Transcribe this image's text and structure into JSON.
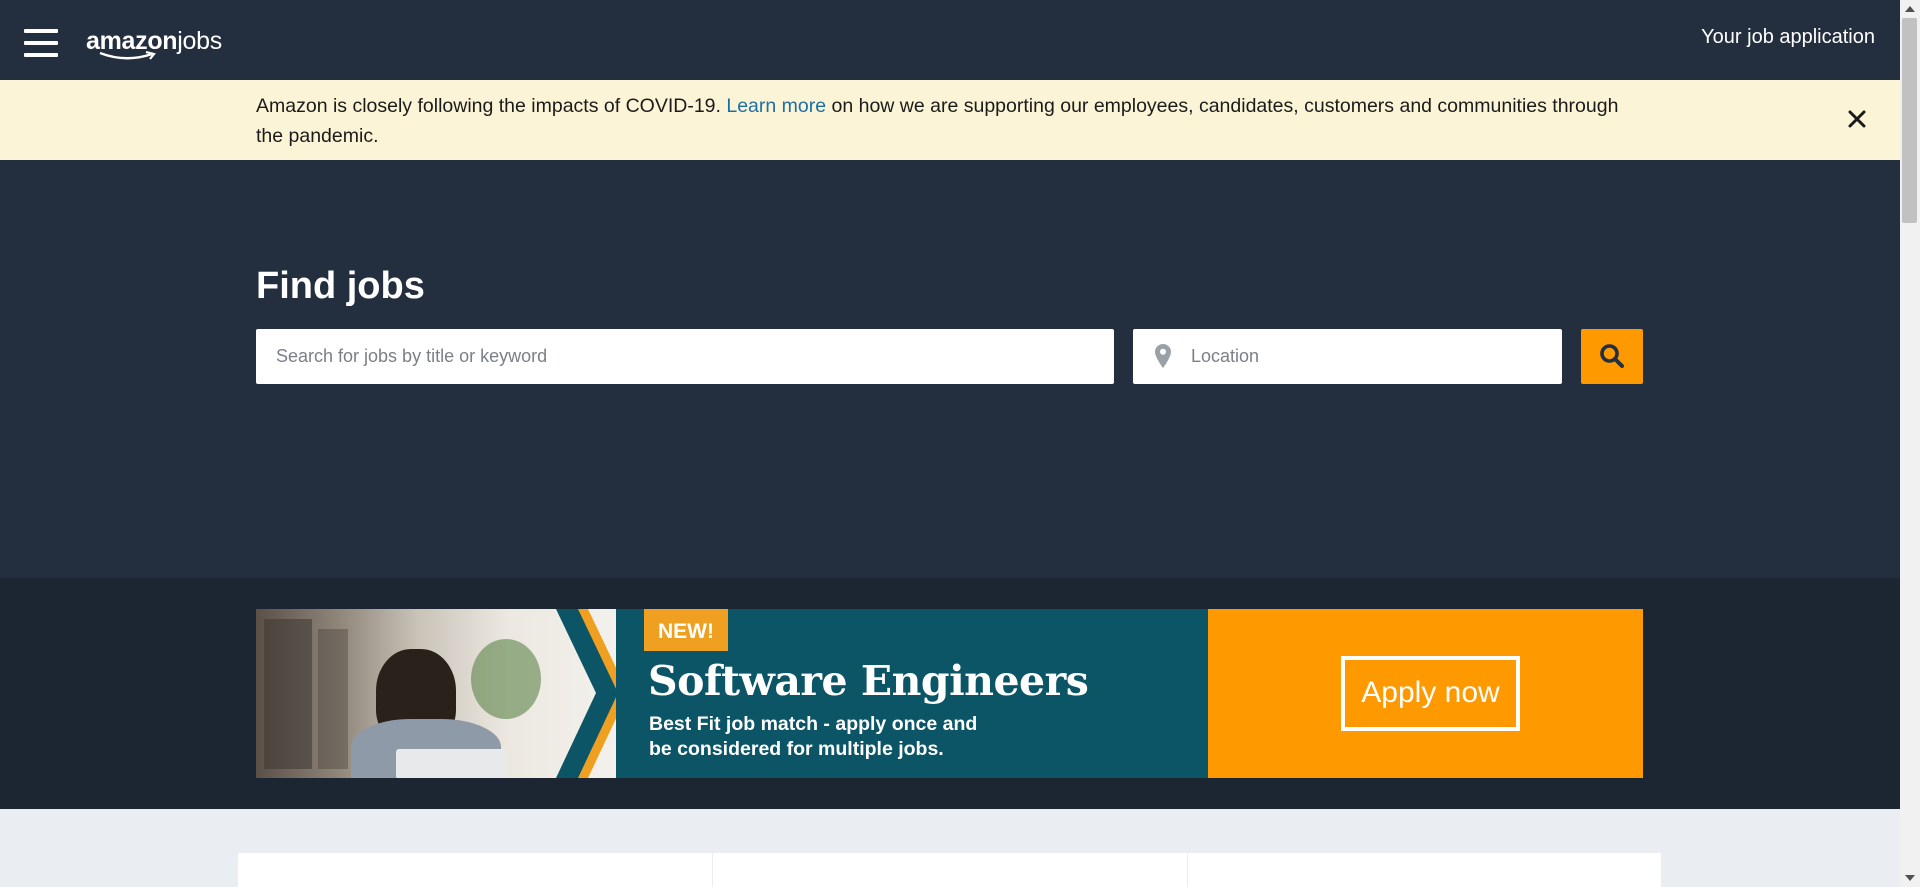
{
  "header": {
    "logo_main": "amazon",
    "logo_sub": "jobs",
    "nav_link": "Your job application"
  },
  "covid_banner": {
    "text_before": "Amazon is closely following the impacts of COVID-19. ",
    "link_text": "Learn more",
    "text_after": " on how we are supporting our employees, candidates, customers and communities through the pandemic."
  },
  "hero": {
    "title": "Find jobs",
    "search_placeholder": "Search for jobs by title or keyword",
    "location_placeholder": "Location"
  },
  "promo": {
    "tag": "NEW!",
    "title": "Software Engineers",
    "subtitle_line1": "Best Fit job match - apply once and",
    "subtitle_line2": "be considered for multiple jobs.",
    "cta": "Apply now"
  },
  "colors": {
    "navy": "#232f3e",
    "banner_yellow": "#fbf4d6",
    "accent_orange": "#ff9900",
    "promo_teal": "#0b5566",
    "link_blue": "#1d6fa5"
  },
  "icons": {
    "menu": "hamburger-icon",
    "close": "close-icon",
    "location": "map-pin-icon",
    "search": "search-icon"
  }
}
